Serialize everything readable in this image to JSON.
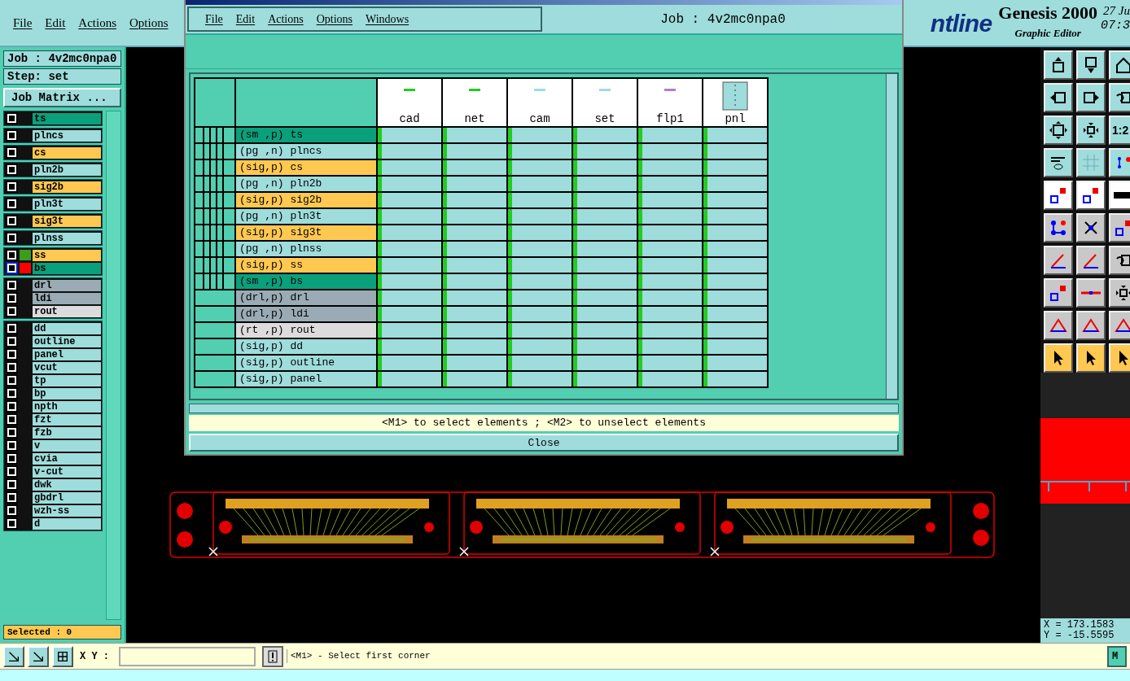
{
  "menu": [
    "File",
    "Edit",
    "Actions",
    "Options"
  ],
  "header": {
    "logo": "ntline",
    "product": "Genesis 2000",
    "subtitle": "Graphic Editor",
    "date": "27 Ju",
    "time": "07:3"
  },
  "left_panel": {
    "job": "Job : 4v2mc0npa0",
    "step": "Step: set",
    "matrix_button": "Job Matrix ...",
    "selected": "Selected : 0",
    "groups": [
      [
        {
          "name": "ts",
          "color": "#0aa07c",
          "work": false
        }
      ],
      [
        {
          "name": "plncs",
          "color": "#9fdcdc",
          "work": false
        }
      ],
      [
        {
          "name": "cs",
          "color": "#ffc850",
          "work": false
        }
      ],
      [
        {
          "name": "pln2b",
          "color": "#9fdcdc",
          "work": false
        }
      ],
      [
        {
          "name": "sig2b",
          "color": "#ffc850",
          "work": false
        }
      ],
      [
        {
          "name": "pln3t",
          "color": "#9fdcdc",
          "work": false
        }
      ],
      [
        {
          "name": "sig3t",
          "color": "#ffc850",
          "work": false
        }
      ],
      [
        {
          "name": "plnss",
          "color": "#9fdcdc",
          "work": false
        }
      ],
      [
        {
          "name": "ss",
          "color": "#ffc850",
          "work": false,
          "swatch": {
            "color": "#3c9c1c"
          }
        },
        {
          "name": "bs",
          "color": "#0aa07c",
          "work": true,
          "swatch": {
            "color": "#ff0000"
          }
        }
      ],
      [
        {
          "name": "drl",
          "color": "#9aabb5",
          "work": false
        },
        {
          "name": "ldi",
          "color": "#9aabb5",
          "work": false
        },
        {
          "name": "rout",
          "color": "#dcdcdc",
          "work": false
        }
      ],
      [
        {
          "name": "dd",
          "color": "#9fdcdc",
          "work": false
        },
        {
          "name": "outline",
          "color": "#9fdcdc",
          "work": false
        },
        {
          "name": "panel",
          "color": "#9fdcdc",
          "work": false
        },
        {
          "name": "vcut",
          "color": "#9fdcdc",
          "work": false
        },
        {
          "name": "tp",
          "color": "#9fdcdc",
          "work": false
        },
        {
          "name": "bp",
          "color": "#9fdcdc",
          "work": false
        },
        {
          "name": "npth",
          "color": "#9fdcdc",
          "work": false
        },
        {
          "name": "fzt",
          "color": "#9fdcdc",
          "work": false
        },
        {
          "name": "fzb",
          "color": "#9fdcdc",
          "work": false
        },
        {
          "name": "v",
          "color": "#9fdcdc",
          "work": false
        },
        {
          "name": "cvia",
          "color": "#9fdcdc",
          "work": false
        },
        {
          "name": "v-cut",
          "color": "#9fdcdc",
          "work": false
        },
        {
          "name": "dwk",
          "color": "#9fdcdc",
          "work": false
        },
        {
          "name": "gbdrl",
          "color": "#9fdcdc",
          "work": false
        },
        {
          "name": "wzh-ss",
          "color": "#9fdcdc",
          "work": false
        },
        {
          "name": "d",
          "color": "#9fdcdc",
          "work": false
        }
      ]
    ]
  },
  "popup": {
    "menu": [
      "File",
      "Edit",
      "Actions",
      "Options",
      "Windows"
    ],
    "job": "Job : 4v2mc0npa0",
    "steps": [
      {
        "name": "cad",
        "kind": "line",
        "color": "#22cc22"
      },
      {
        "name": "net",
        "kind": "line",
        "color": "#22cc22"
      },
      {
        "name": "cam",
        "kind": "line",
        "color": "#9fdcdc"
      },
      {
        "name": "set",
        "kind": "line",
        "color": "#9fdcdc"
      },
      {
        "name": "flp1",
        "kind": "line",
        "color": "#b080c0"
      },
      {
        "name": "pnl",
        "kind": "panel"
      }
    ],
    "layers": [
      {
        "label": "(sm ,p) ts",
        "color": "#0aa07c",
        "board": true
      },
      {
        "label": "(pg ,n) plncs",
        "color": "#9fdcdc",
        "board": true
      },
      {
        "label": "(sig,p) cs",
        "color": "#ffc850",
        "board": true
      },
      {
        "label": "(pg ,n) pln2b",
        "color": "#9fdcdc",
        "board": true
      },
      {
        "label": "(sig,p) sig2b",
        "color": "#ffc850",
        "board": true
      },
      {
        "label": "(pg ,n) pln3t",
        "color": "#9fdcdc",
        "board": true
      },
      {
        "label": "(sig,p) sig3t",
        "color": "#ffc850",
        "board": true
      },
      {
        "label": "(pg ,n) plnss",
        "color": "#9fdcdc",
        "board": true
      },
      {
        "label": "(sig,p) ss",
        "color": "#ffc850",
        "board": true
      },
      {
        "label": "(sm ,p) bs",
        "color": "#0aa07c",
        "board": true
      },
      {
        "label": "(drl,p) drl",
        "color": "#9aabb5",
        "board": false
      },
      {
        "label": "(drl,p) ldi",
        "color": "#9aabb5",
        "board": false
      },
      {
        "label": "(rt ,p) rout",
        "color": "#dcdcdc",
        "board": false
      },
      {
        "label": "(sig,p) dd",
        "color": "#9fdcdc",
        "board": false
      },
      {
        "label": "(sig,p) outline",
        "color": "#9fdcdc",
        "board": false
      },
      {
        "label": "(sig,p) panel",
        "color": "#9fdcdc",
        "board": false
      }
    ],
    "hint": "<M1> to select elements ; <M2> to unselect elements",
    "close": "Close"
  },
  "toolbar": {
    "scale_label": "1:2"
  },
  "coords": {
    "x": "X = 173.1583",
    "y": "Y = -15.5595"
  },
  "status_bar": {
    "xy_label": "X Y :",
    "prompt": "<M1> - Select first corner",
    "units": "M"
  }
}
